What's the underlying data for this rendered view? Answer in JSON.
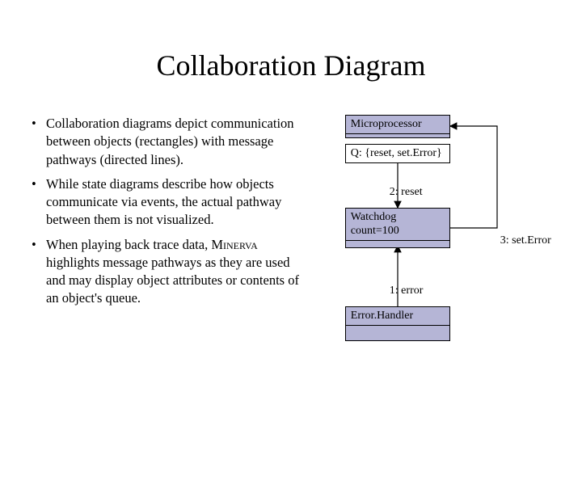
{
  "title": "Collaboration Diagram",
  "bullets": [
    "Collaboration diagrams depict communication between objects (rectangles) with message pathways (directed lines).",
    "While state diagrams describe how objects communicate via events, the actual pathway between them is not visualized.",
    "When playing back trace data, MINERVA highlights message pathways as they are used and may display object attributes or contents of an object's queue."
  ],
  "diagram": {
    "objects": {
      "micro": {
        "name": "Microprocessor",
        "attrs": ""
      },
      "queue": {
        "name": "Q: {reset, set.Error}",
        "attrs": ""
      },
      "watchdog": {
        "name": "Watchdog",
        "attrs": "count=100"
      },
      "handler": {
        "name": "Error.Handler",
        "attrs": ""
      }
    },
    "messages": {
      "m2": "2: reset",
      "m3": "3: set.Error",
      "m1": "1: error"
    }
  }
}
